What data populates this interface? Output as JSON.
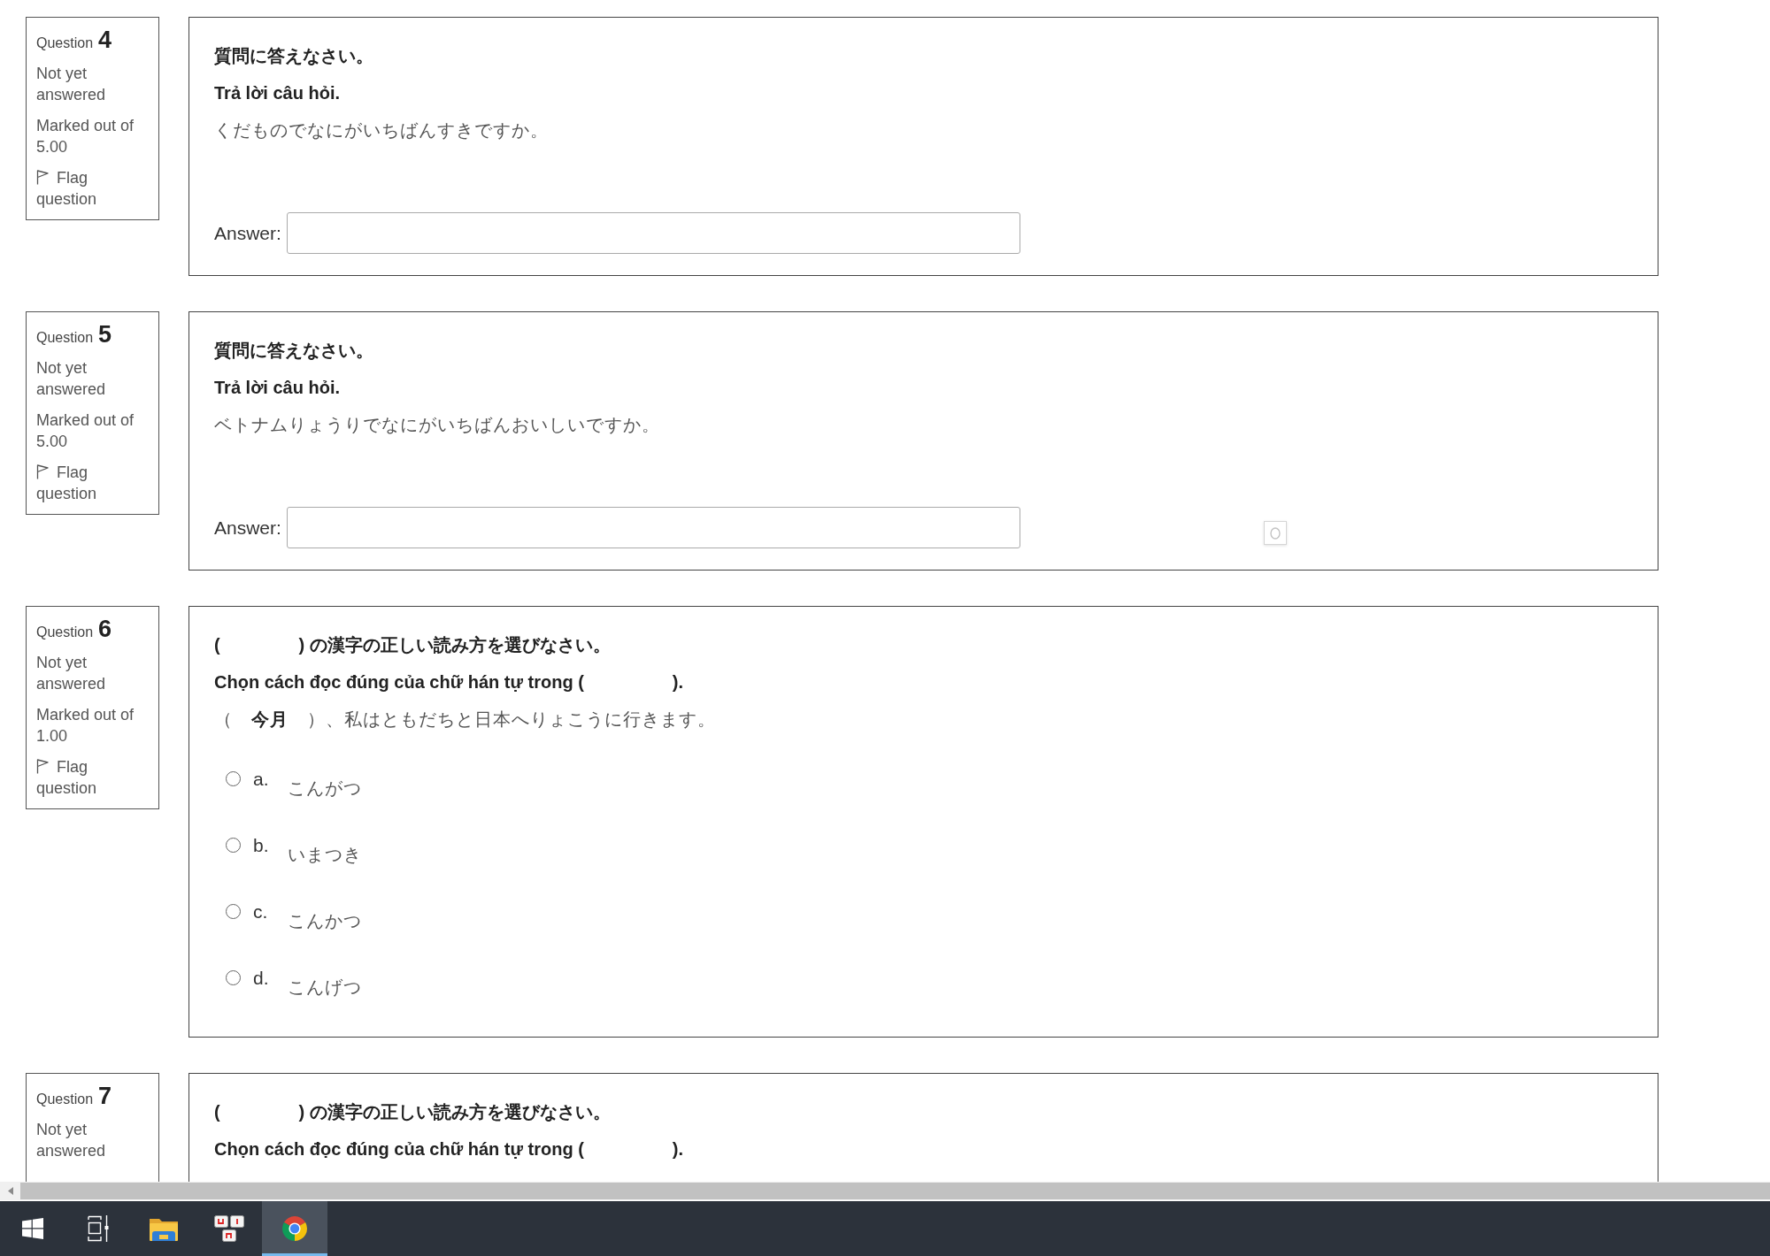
{
  "questions": [
    {
      "label": "Question",
      "number": "4",
      "status": "Not yet answered",
      "marks": "Marked out of 5.00",
      "flag": "Flag question",
      "kind": "short-answer",
      "floating_icon": false,
      "lines": [
        {
          "kind": "instruction",
          "text": "質問に答えなさい。"
        },
        {
          "kind": "instruction",
          "text": "Trả lời câu hỏi."
        },
        {
          "kind": "sentence",
          "text": "くだものでなにがいちばんすきですか。"
        }
      ],
      "answer_label": "Answer:"
    },
    {
      "label": "Question",
      "number": "5",
      "status": "Not yet answered",
      "marks": "Marked out of 5.00",
      "flag": "Flag question",
      "kind": "short-answer",
      "floating_icon": true,
      "lines": [
        {
          "kind": "instruction",
          "text": "質問に答えなさい。"
        },
        {
          "kind": "instruction",
          "text": "Trả lời câu hỏi."
        },
        {
          "kind": "sentence",
          "text": "ベトナムりょうりでなにがいちばんおいしいですか。"
        }
      ],
      "answer_label": "Answer:"
    },
    {
      "label": "Question",
      "number": "6",
      "status": "Not yet answered",
      "marks": "Marked out of 1.00",
      "flag": "Flag question",
      "kind": "multiple-choice",
      "floating_icon": false,
      "lines": [
        {
          "kind": "instruction",
          "text": "(                ) の漢字の正しい読み方を選びなさい。"
        },
        {
          "kind": "instruction",
          "text": "Chọn cách đọc đúng của chữ hán tự trong (                  )."
        },
        {
          "kind": "sentence",
          "text": "（　**今月**　）、私はともだちと日本へりょこうに行きます。"
        }
      ],
      "options": [
        {
          "letter": "a.",
          "text": "こんがつ",
          "selected": false
        },
        {
          "letter": "b.",
          "text": "いまつき",
          "selected": false
        },
        {
          "letter": "c.",
          "text": "こんかつ",
          "selected": false
        },
        {
          "letter": "d.",
          "text": "こんげつ",
          "selected": false
        }
      ]
    },
    {
      "label": "Question",
      "number": "7",
      "status": "Not yet answered",
      "kind": "multiple-choice",
      "lines": [
        {
          "kind": "instruction",
          "text": "(                ) の漢字の正しい読み方を選びなさい。"
        },
        {
          "kind": "instruction",
          "text": "Chọn cách đọc đúng của chữ hán tự trong (                  )."
        }
      ]
    }
  ],
  "taskbar": {
    "pinned": [
      {
        "kind": "file-explorer",
        "selected": false
      },
      {
        "kind": "keyboard",
        "selected": false
      },
      {
        "kind": "browser",
        "selected": true
      }
    ]
  }
}
